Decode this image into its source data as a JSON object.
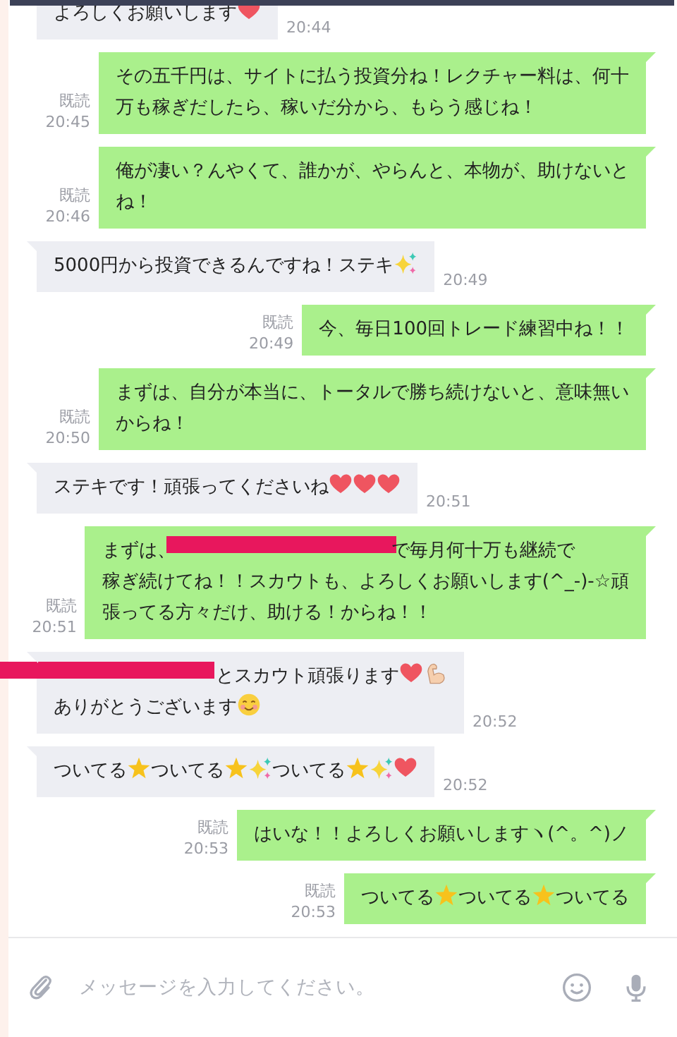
{
  "messages": [
    {
      "kind": "received",
      "time": "20:44",
      "parts": [
        {
          "kind": "text",
          "text": "よろしくお願いします"
        },
        {
          "kind": "heart"
        }
      ]
    },
    {
      "kind": "sent",
      "read": "既読",
      "time": "20:45",
      "parts": [
        {
          "kind": "text",
          "text": "その五千円は、サイトに払う投資分ね！レクチャー料は、何十"
        },
        {
          "kind": "break"
        },
        {
          "kind": "text",
          "text": "万も稼ぎだしたら、稼いだ分から、もらう感じね！"
        }
      ]
    },
    {
      "kind": "sent",
      "read": "既読",
      "time": "20:46",
      "parts": [
        {
          "kind": "text",
          "text": "俺が凄い？んやくて、誰かが、やらんと、本物が、助けないと"
        },
        {
          "kind": "break"
        },
        {
          "kind": "text",
          "text": "ね！"
        }
      ]
    },
    {
      "kind": "received",
      "time": "20:49",
      "parts": [
        {
          "kind": "text",
          "text": "5000円から投資できるんですね！ステキ"
        },
        {
          "kind": "sparkle"
        }
      ]
    },
    {
      "kind": "sent",
      "read": "既読",
      "time": "20:49",
      "parts": [
        {
          "kind": "text",
          "text": "今、毎日100回トレード練習中ね！！"
        }
      ]
    },
    {
      "kind": "sent",
      "read": "既読",
      "time": "20:50",
      "parts": [
        {
          "kind": "text",
          "text": "まずは、自分が本当に、トータルで勝ち続けないと、意味無い"
        },
        {
          "kind": "break"
        },
        {
          "kind": "text",
          "text": "からね！"
        }
      ]
    },
    {
      "kind": "received",
      "time": "20:51",
      "parts": [
        {
          "kind": "text",
          "text": "ステキです！頑張ってくださいね"
        },
        {
          "kind": "heart"
        },
        {
          "kind": "heart"
        },
        {
          "kind": "heart"
        }
      ]
    },
    {
      "kind": "sent",
      "read": "既読",
      "time": "20:51",
      "parts": [
        {
          "kind": "text",
          "text": "まずは、"
        },
        {
          "kind": "redaction"
        },
        {
          "kind": "text",
          "text": "で毎月何十万も継続で"
        },
        {
          "kind": "break"
        },
        {
          "kind": "text",
          "text": "稼ぎ続けてね！！スカウトも、よろしくお願いします(^_-)-☆頑"
        },
        {
          "kind": "break"
        },
        {
          "kind": "text",
          "text": "張ってる方々だけ、助ける！からね！！"
        }
      ]
    },
    {
      "kind": "received",
      "time": "20:52",
      "parts": [
        {
          "kind": "redaction"
        },
        {
          "kind": "text",
          "text": "とスカウト頑張ります"
        },
        {
          "kind": "heart"
        },
        {
          "kind": "arm"
        },
        {
          "kind": "break"
        },
        {
          "kind": "text",
          "text": "ありがとうございます"
        },
        {
          "kind": "smile"
        }
      ]
    },
    {
      "kind": "received",
      "time": "20:52",
      "parts": [
        {
          "kind": "text",
          "text": "ついてる"
        },
        {
          "kind": "star"
        },
        {
          "kind": "text",
          "text": "ついてる"
        },
        {
          "kind": "star"
        },
        {
          "kind": "sparkle"
        },
        {
          "kind": "text",
          "text": "ついてる"
        },
        {
          "kind": "star"
        },
        {
          "kind": "sparkle"
        },
        {
          "kind": "heart"
        }
      ]
    },
    {
      "kind": "sent",
      "read": "既読",
      "time": "20:53",
      "parts": [
        {
          "kind": "text",
          "text": "はいな！！よろしくお願いしますヽ(^。^)ノ"
        }
      ]
    },
    {
      "kind": "sent",
      "read": "既読",
      "time": "20:53",
      "parts": [
        {
          "kind": "text",
          "text": "ついてる"
        },
        {
          "kind": "star"
        },
        {
          "kind": "text",
          "text": "ついてる"
        },
        {
          "kind": "star"
        },
        {
          "kind": "text",
          "text": "ついてる"
        }
      ]
    }
  ],
  "composer": {
    "placeholder": "メッセージを入力してください。"
  }
}
